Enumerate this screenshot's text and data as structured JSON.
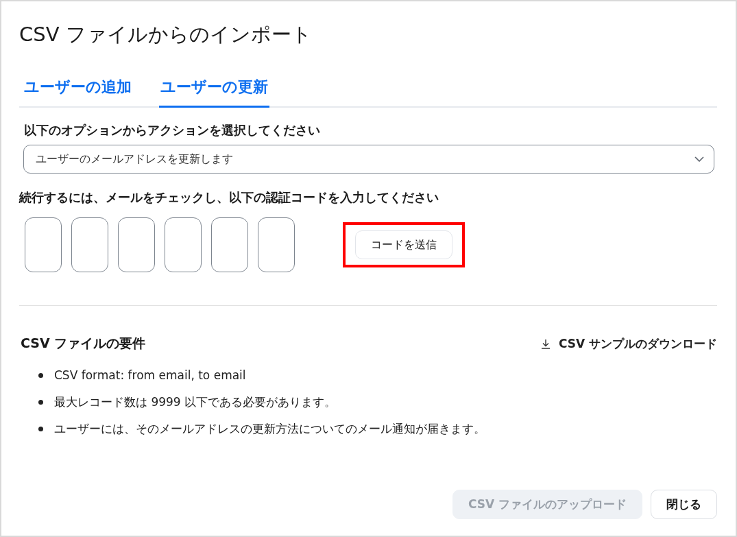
{
  "window": {
    "title": "CSV ファイルからのインポート"
  },
  "tabs": [
    {
      "label": "ユーザーの追加",
      "selected": false
    },
    {
      "label": "ユーザーの更新",
      "selected": true
    }
  ],
  "action": {
    "label": "以下のオプションからアクションを選択してください",
    "value": "ユーザーのメールアドレスを更新します"
  },
  "verification": {
    "prompt": "続行するには、メールをチェックし、以下の認証コードを入力してください",
    "code_boxes": [
      {
        "kind": "digit"
      },
      {
        "kind": "digit"
      },
      {
        "kind": "digit"
      },
      {
        "kind": "digit"
      },
      {
        "kind": "digit"
      },
      {
        "kind": "digit"
      }
    ],
    "send_button": {
      "label": "コードを送信",
      "highlighted": true
    }
  },
  "requirements": {
    "title": "CSV ファイルの要件",
    "download_link": "CSV サンプルのダウンロード",
    "items": [
      "CSV format: from email, to email",
      "最大レコード数は 9999 以下である必要があります。",
      "ユーザーには、そのメールアドレスの更新方法についてのメール通知が届きます。"
    ]
  },
  "buttons": [
    {
      "label": "CSV ファイルのアップロード",
      "disabled": true
    },
    {
      "label": "閉じる",
      "disabled": false
    }
  ]
}
